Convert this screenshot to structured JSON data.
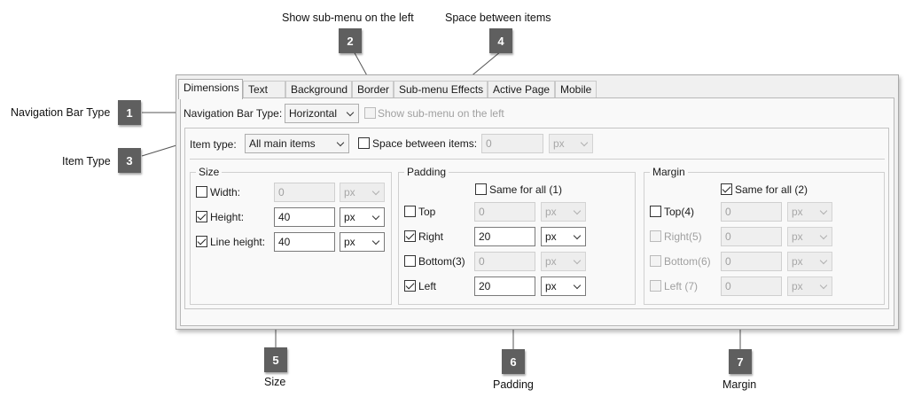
{
  "callouts": {
    "c1": {
      "number": "1",
      "label": "Navigation Bar Type"
    },
    "c2": {
      "number": "2",
      "label": "Show sub-menu on the left"
    },
    "c3": {
      "number": "3",
      "label": "Item Type"
    },
    "c4": {
      "number": "4",
      "label": "Space between items"
    },
    "c5": {
      "number": "5",
      "label": "Size"
    },
    "c6": {
      "number": "6",
      "label": "Padding"
    },
    "c7": {
      "number": "7",
      "label": "Margin"
    }
  },
  "tabs": [
    "Dimensions",
    "Text",
    "Background",
    "Border",
    "Sub-menu Effects",
    "Active Page",
    "Mobile"
  ],
  "nav": {
    "type_label": "Navigation Bar Type:",
    "type_value": "Horizontal",
    "show_submenu_label": "Show sub-menu on the left",
    "show_submenu_checked": false
  },
  "item": {
    "type_label": "Item type:",
    "type_value": "All main items",
    "space_label": "Space between items:",
    "space_checked": false,
    "space_value": "0",
    "space_unit": "px"
  },
  "size": {
    "title": "Size",
    "width_label": "Width:",
    "width_value": "0",
    "width_unit": "px",
    "width_checked": false,
    "height_label": "Height:",
    "height_value": "40",
    "height_unit": "px",
    "height_checked": true,
    "line_label": "Line height:",
    "line_value": "40",
    "line_unit": "px",
    "line_checked": true
  },
  "padding": {
    "title": "Padding",
    "same_label": "Same for all (1)",
    "same_checked": false,
    "top_label": "Top",
    "top_value": "0",
    "top_unit": "px",
    "right_label": "Right",
    "right_value": "20",
    "right_unit": "px",
    "bottom_label": "Bottom(3)",
    "bottom_value": "0",
    "bottom_unit": "px",
    "left_label": "Left",
    "left_value": "20",
    "left_unit": "px"
  },
  "margin": {
    "title": "Margin",
    "same_label": "Same for all (2)",
    "same_checked": true,
    "top_label": "Top(4)",
    "top_value": "0",
    "top_unit": "px",
    "right_label": "Right(5)",
    "right_value": "0",
    "right_unit": "px",
    "bottom_label": "Bottom(6)",
    "bottom_value": "0",
    "bottom_unit": "px",
    "left_label": "Left (7)",
    "left_value": "0",
    "left_unit": "px"
  },
  "colors": {
    "badge": "#5f5f5f",
    "dialog_bg": "#f0f0f0",
    "panel_bg": "#f9f9f9"
  }
}
